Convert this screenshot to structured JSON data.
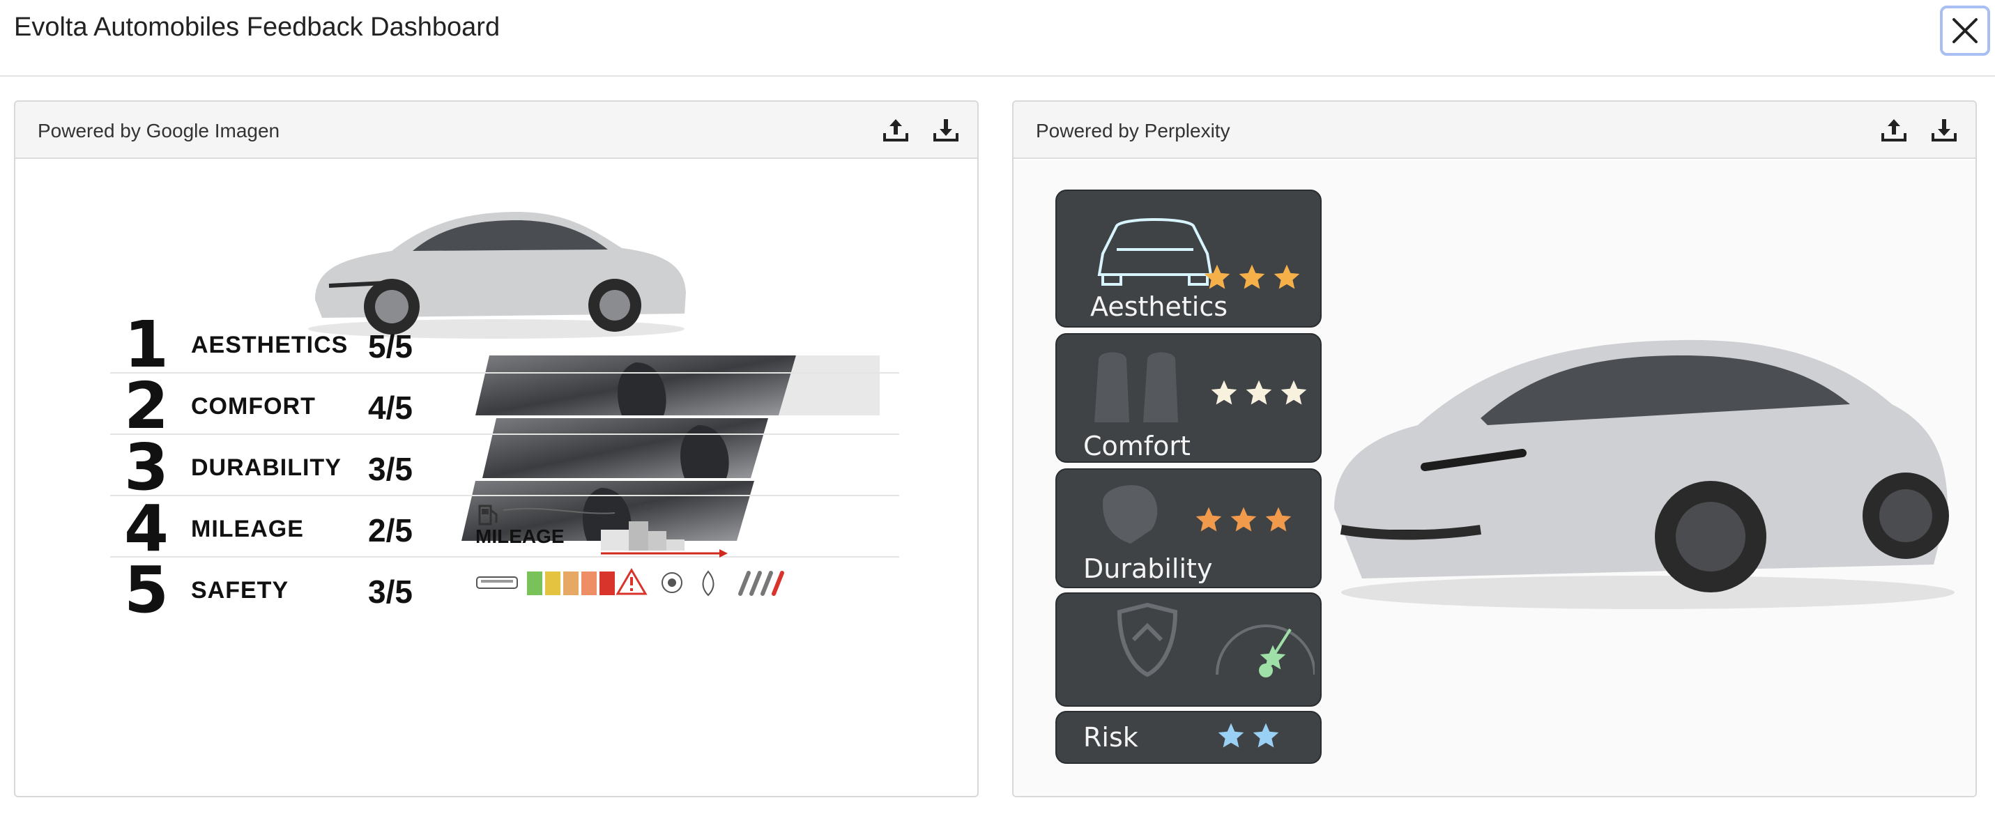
{
  "header": {
    "title": "Evolta Automobiles Feedback Dashboard",
    "close_icon": "close-icon"
  },
  "left_panel": {
    "caption": "Powered by Google Imagen",
    "icons": [
      "share-upload-icon",
      "download-icon"
    ],
    "ratings": [
      {
        "rank": "1",
        "metric": "AESTHETICS",
        "score": "5/5"
      },
      {
        "rank": "2",
        "metric": "COMFORT",
        "score": "4/5"
      },
      {
        "rank": "3",
        "metric": "DURABILITY",
        "score": "3/5"
      },
      {
        "rank": "4",
        "metric": "MILEAGE",
        "score": "2/5"
      },
      {
        "rank": "5",
        "metric": "SAFETY",
        "score": "3/5"
      }
    ],
    "mileage_graphic_label": "MILEAGE",
    "mileage_graphic_tick": "1/5",
    "safety_colors": [
      "#79c25a",
      "#e3c33f",
      "#e8a865",
      "#ee8e65",
      "#d9342c"
    ]
  },
  "right_panel": {
    "caption": "Powered by Perplexity",
    "icons": [
      "share-upload-icon",
      "download-icon"
    ],
    "cards": [
      {
        "label": "Aesthetics",
        "icon": "car-outline-icon",
        "stars": 3,
        "star_color": "#f5b04a"
      },
      {
        "label": "Comfort",
        "icon": "seats-icon",
        "stars": 3,
        "star_color": "#f7f1de"
      },
      {
        "label": "Durability",
        "icon": "seat-shape-icon",
        "stars": 3,
        "star_color": "#f29a4c"
      },
      {
        "label": "",
        "icon": "shield-gauge-icon",
        "stars": 1,
        "star_color": "#9fe0a8"
      },
      {
        "label": "Risk",
        "icon": "",
        "stars": 2,
        "star_color": "#9ad0f4"
      }
    ]
  }
}
